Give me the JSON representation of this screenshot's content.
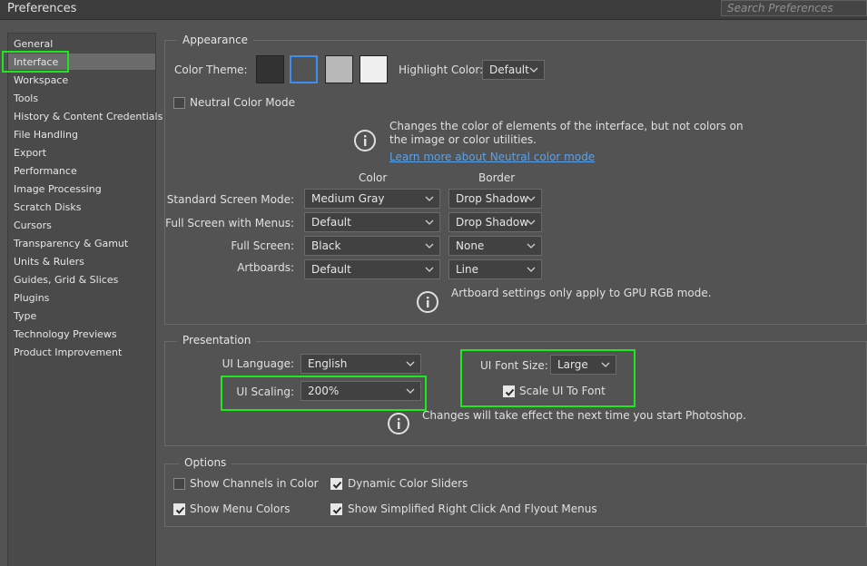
{
  "window": {
    "title": "Preferences",
    "search_placeholder": "Search Preferences"
  },
  "sidebar": {
    "selected": "Interface",
    "items": [
      {
        "label": "General"
      },
      {
        "label": "Interface"
      },
      {
        "label": "Workspace"
      },
      {
        "label": "Tools"
      },
      {
        "label": "History & Content Credentials"
      },
      {
        "label": "File Handling"
      },
      {
        "label": "Export"
      },
      {
        "label": "Performance"
      },
      {
        "label": "Image Processing"
      },
      {
        "label": "Scratch Disks"
      },
      {
        "label": "Cursors"
      },
      {
        "label": "Transparency & Gamut"
      },
      {
        "label": "Units & Rulers"
      },
      {
        "label": "Guides, Grid & Slices"
      },
      {
        "label": "Plugins"
      },
      {
        "label": "Type"
      },
      {
        "label": "Technology Previews"
      },
      {
        "label": "Product Improvement"
      }
    ]
  },
  "appearance": {
    "legend": "Appearance",
    "color_theme_label": "Color Theme:",
    "themes": [
      {
        "color": "#323232"
      },
      {
        "color": "#535353",
        "selected": true
      },
      {
        "color": "#b8b8b8"
      },
      {
        "color": "#f0f0f0"
      }
    ],
    "highlight_color_label": "Highlight Color:",
    "highlight_color_value": "Default",
    "neutral_color_mode_label": "Neutral Color Mode",
    "neutral_color_mode_checked": false,
    "neutral_info": "Changes the color of elements of the interface, but not colors on the image or color utilities.",
    "neutral_link": "Learn more about Neutral color mode",
    "col_color": "Color",
    "col_border": "Border",
    "modes": [
      {
        "label": "Standard Screen Mode:",
        "color": "Medium Gray",
        "border": "Drop Shadow"
      },
      {
        "label": "Full Screen with Menus:",
        "color": "Default",
        "border": "Drop Shadow"
      },
      {
        "label": "Full Screen:",
        "color": "Black",
        "border": "None"
      },
      {
        "label": "Artboards:",
        "color": "Default",
        "border": "Line"
      }
    ],
    "artboard_info": "Artboard settings only apply to GPU RGB mode."
  },
  "presentation": {
    "legend": "Presentation",
    "ui_language_label": "UI Language:",
    "ui_language_value": "English",
    "ui_scaling_label": "UI Scaling:",
    "ui_scaling_value": "200%",
    "ui_font_size_label": "UI Font Size:",
    "ui_font_size_value": "Large",
    "scale_ui_label": "Scale UI To Font",
    "scale_ui_checked": true,
    "restart_info": "Changes will take effect the next time you start Photoshop."
  },
  "options": {
    "legend": "Options",
    "show_channels_label": "Show Channels in Color",
    "show_channels_checked": false,
    "dynamic_sliders_label": "Dynamic Color Sliders",
    "dynamic_sliders_checked": true,
    "show_menu_colors_label": "Show Menu Colors",
    "show_menu_colors_checked": true,
    "simplified_menus_label": "Show Simplified Right Click And Flyout Menus",
    "simplified_menus_checked": true
  },
  "colors": {
    "highlight_frame": "#1ee81e",
    "link": "#5aa2e8",
    "background": "#535353"
  }
}
